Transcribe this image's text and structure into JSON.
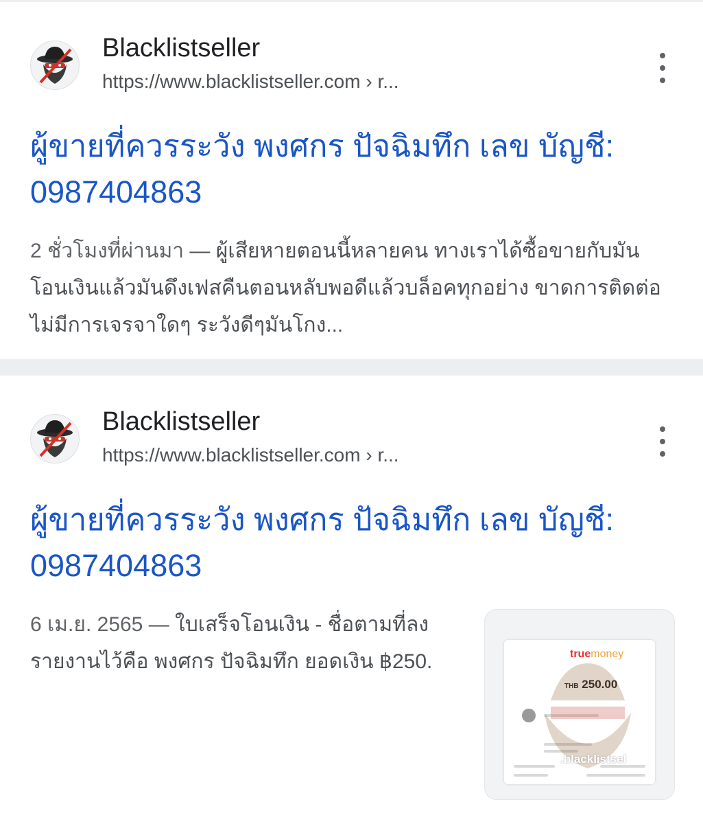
{
  "results": [
    {
      "site_name": "Blacklistseller",
      "url": "https://www.blacklistseller.com › r...",
      "title": "ผู้ขายที่ควรระวัง พงศกร ปัจฉิมทึก เลข บัญชี: 0987404863",
      "date": "2 ชั่วโมงที่ผ่านมา",
      "snippet": " — ผู้เสียหายตอนนี้หลายคน ทางเราได้ซื้อขายกับมันโอนเงินแล้วมันดึงเฟสคืนตอนหลับพอดีแล้วบล็อคทุกอย่าง ขาดการติดต่อ ไม่มีการเจรจาใดๆ ระวังดีๆมันโกง...",
      "menu_icon": "more-vert-icon"
    },
    {
      "site_name": "Blacklistseller",
      "url": "https://www.blacklistseller.com › r...",
      "title": "ผู้ขายที่ควรระวัง พงศกร ปัจฉิมทึก เลข บัญชี: 0987404863",
      "date": "6 เม.ย. 2565",
      "snippet": " — ใบเสร็จโอนเงิน - ชื่อตามที่ลงรายงานไว้คือ พงศกร ปัจฉิมทึก ยอดเงิน ฿250.",
      "menu_icon": "more-vert-icon",
      "thumbnail": {
        "brand_true": "true",
        "brand_money": "money",
        "currency": "THB",
        "amount": "250.00",
        "watermark": ".blacklistsel"
      }
    }
  ],
  "colors": {
    "title": "#1a56c6",
    "snippet": "#4d5156",
    "separator": "#eceff1"
  }
}
